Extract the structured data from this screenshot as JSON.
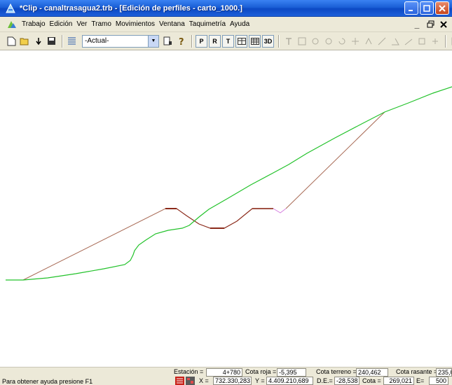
{
  "window": {
    "title": "*Clip - canaltrasagua2.trb - [Edición de perfiles - carto_1000.]"
  },
  "menu": {
    "items": [
      "Trabajo",
      "Edición",
      "Ver",
      "Tramo",
      "Movimientos",
      "Ventana",
      "Taquimetría",
      "Ayuda"
    ]
  },
  "toolbar": {
    "profile_select": "-Actual-",
    "btn_p": "P",
    "btn_r": "R",
    "btn_t": "T",
    "btn_3d": "3D"
  },
  "status": {
    "help_text": "Para obtener ayuda presione F1",
    "estacion_label": "Estación =",
    "estacion_value": "4+780",
    "cota_roja_label": "Cota roja =",
    "cota_roja_value": "-5,395",
    "cota_terreno_label": "Cota terreno =",
    "cota_terreno_value": "240,462",
    "cota_rasante_label": "Cota rasante =",
    "cota_rasante_value": "235,0",
    "x_label": "X =",
    "x_value": "732.330,283",
    "y_label": "Y =",
    "y_value": "4.409.210,689",
    "de_label": "D.E.=",
    "de_value": "-28,538",
    "cota_label": "Cota =",
    "cota_value": "269,021",
    "e_label": "E=",
    "e_value": "500"
  },
  "colors": {
    "terrain": "#22c22a",
    "section": "#a86a55",
    "section_dark": "#8b2a1a",
    "highlight": "#d680e0"
  }
}
